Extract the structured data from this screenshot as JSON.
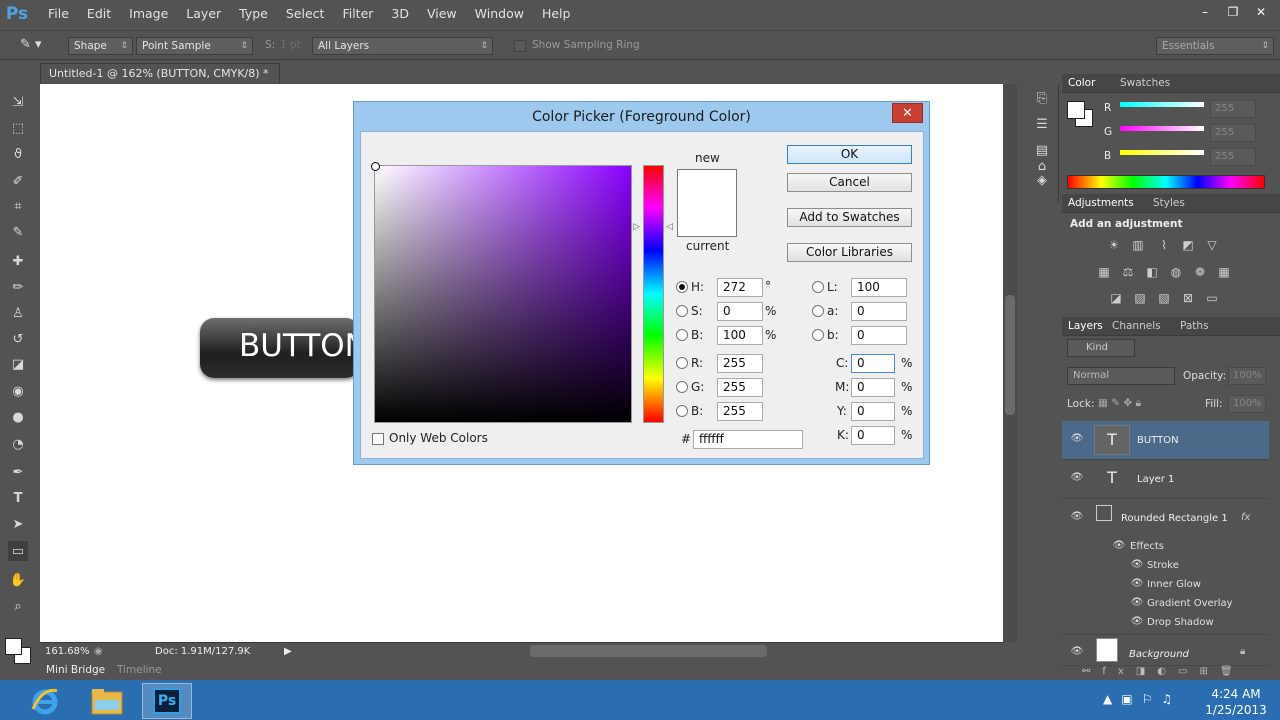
{
  "menubar": {
    "logo": "Ps",
    "items": [
      "File",
      "Edit",
      "Image",
      "Layer",
      "Type",
      "Select",
      "Filter",
      "3D",
      "View",
      "Window",
      "Help"
    ],
    "window_controls": [
      "–",
      "❐",
      "✕"
    ]
  },
  "options": {
    "mode": "Shape",
    "sample": "Point Sample",
    "size_label": "S:",
    "size_value": "1 pt",
    "layers": "All Layers",
    "ring_label": "Show Sampling Ring",
    "workspace": "Essentials"
  },
  "document": {
    "tab": "Untitled-1 @ 162% (BUTTON, CMYK/8) *",
    "tab_close": "×",
    "canvas_text": "BUTTON",
    "zoom": "161.68%",
    "doc_info": "Doc: 1.91M/127.9K"
  },
  "bottom_tabs": [
    "Mini Bridge",
    "Timeline"
  ],
  "dialog": {
    "title": "Color Picker (Foreground Color)",
    "close": "✕",
    "new_label": "new",
    "current_label": "current",
    "buttons": {
      "ok": "OK",
      "cancel": "Cancel",
      "swatches": "Add to Swatches",
      "libraries": "Color Libraries"
    },
    "hsb": {
      "h_label": "H:",
      "h": "272",
      "h_unit": "°",
      "s_label": "S:",
      "s": "0",
      "s_unit": "%",
      "b_label": "B:",
      "b": "100",
      "b_unit": "%"
    },
    "rgb": {
      "r_label": "R:",
      "r": "255",
      "g_label": "G:",
      "g": "255",
      "b_label": "B:",
      "b": "255"
    },
    "lab": {
      "l_label": "L:",
      "l": "100",
      "a_label": "a:",
      "a": "0",
      "b_label": "b:",
      "b": "0"
    },
    "cmyk": {
      "c_label": "C:",
      "c": "0",
      "m_label": "M:",
      "m": "0",
      "y_label": "Y:",
      "y": "0",
      "k_label": "K:",
      "k": "0",
      "unit": "%"
    },
    "hex_label": "#",
    "hex": "ffffff",
    "web_only": "Only Web Colors"
  },
  "color_panel": {
    "tabs": [
      "Color",
      "Swatches"
    ],
    "r_label": "R",
    "g_label": "G",
    "b_label": "B",
    "r": "255",
    "g": "255",
    "b": "255"
  },
  "adjust_panel": {
    "tabs": [
      "Adjustments",
      "Styles"
    ],
    "heading": "Add an adjustment"
  },
  "layers_panel": {
    "tabs": [
      "Layers",
      "Channels",
      "Paths"
    ],
    "kind": "Kind",
    "blend": "Normal",
    "opacity_label": "Opacity:",
    "opacity": "100%",
    "lock_label": "Lock:",
    "fill_label": "Fill:",
    "fill": "100%",
    "layers": [
      {
        "name": "BUTTON",
        "thumb": "T"
      },
      {
        "name": "Layer 1",
        "thumb": "T"
      },
      {
        "name": "Rounded Rectangle 1",
        "fx": "fx"
      }
    ],
    "effects_label": "Effects",
    "effects": [
      "Stroke",
      "Inner Glow",
      "Gradient Overlay",
      "Drop Shadow"
    ],
    "background": "Background"
  },
  "taskbar": {
    "apps": [
      "Internet Explorer",
      "File Explorer",
      "Photoshop"
    ],
    "ps_label": "Ps",
    "time": "4:24 AM",
    "date": "1/25/2013"
  },
  "colors": {
    "accent": "#2a6db0",
    "dialog_frame": "#9ec9ee",
    "selected_layer": "#4b6a8a"
  }
}
